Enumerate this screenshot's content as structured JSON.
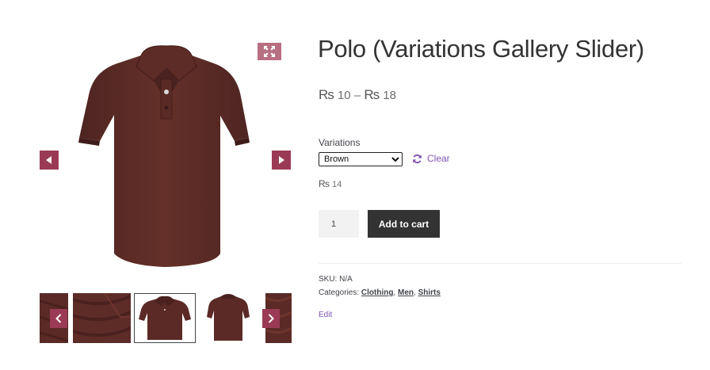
{
  "product": {
    "title": "Polo (Variations Gallery Slider)",
    "price_range": {
      "currency": "₨",
      "min": "10",
      "separator": "–",
      "max": "18"
    },
    "variation": {
      "label": "Variations",
      "selected": "Brown",
      "clear_label": "Clear",
      "price_currency": "₨",
      "price": "14"
    },
    "quantity": "1",
    "add_to_cart_label": "Add to cart",
    "meta": {
      "sku_label": "SKU:",
      "sku_value": "N/A",
      "categories_label": "Categories:",
      "categories": [
        "Clothing",
        "Men",
        "Shirts"
      ]
    },
    "edit_label": "Edit"
  },
  "gallery": {
    "thumbnail_count": 5,
    "selected_thumbnail": 3,
    "colors": {
      "shirt": "#5b2a26",
      "shirt_shade": "#4a211e",
      "nav": "#9b3a55",
      "zoom": "#b86f82"
    }
  },
  "colors": {
    "accent": "#7f54b3",
    "button": "#333333"
  }
}
